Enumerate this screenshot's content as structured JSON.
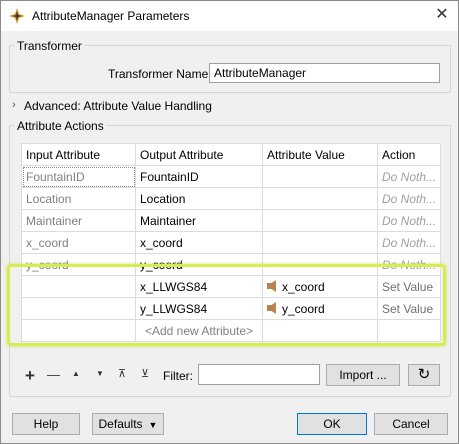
{
  "window": {
    "title": "AttributeManager Parameters",
    "close": "✕"
  },
  "transformer": {
    "group_label": "Transformer",
    "name_label": "Transformer Name:",
    "name_value": "AttributeManager"
  },
  "advanced": {
    "label": "Advanced: Attribute Value Handling"
  },
  "actions": {
    "group_label": "Attribute Actions",
    "columns": [
      "Input Attribute",
      "Output Attribute",
      "Attribute Value",
      "Action"
    ],
    "rows": [
      {
        "input": "FountainID",
        "output": "FountainID",
        "value": "",
        "action": "Do Noth..."
      },
      {
        "input": "Location",
        "output": "Location",
        "value": "",
        "action": "Do Noth..."
      },
      {
        "input": "Maintainer",
        "output": "Maintainer",
        "value": "",
        "action": "Do Noth..."
      },
      {
        "input": "x_coord",
        "output": "x_coord",
        "value": "",
        "action": "Do Noth..."
      },
      {
        "input": "y_coord",
        "output": "y_coord",
        "value": "",
        "action": "Do Noth..."
      },
      {
        "input": "",
        "output": "x_LLWGS84",
        "value": "x_coord",
        "action": "Set Value"
      },
      {
        "input": "",
        "output": "y_LLWGS84",
        "value": "y_coord",
        "action": "Set Value"
      }
    ],
    "add_new": "<Add new Attribute>"
  },
  "toolbar": {
    "add": "+",
    "remove": "—",
    "up": "▲",
    "down": "▼",
    "top": "⊼",
    "bottom": "⊻",
    "filter_label": "Filter:",
    "filter_value": "",
    "import_label": "Import ...",
    "refresh": "↻"
  },
  "footer": {
    "help": "Help",
    "defaults": "Defaults",
    "ok": "OK",
    "cancel": "Cancel"
  }
}
